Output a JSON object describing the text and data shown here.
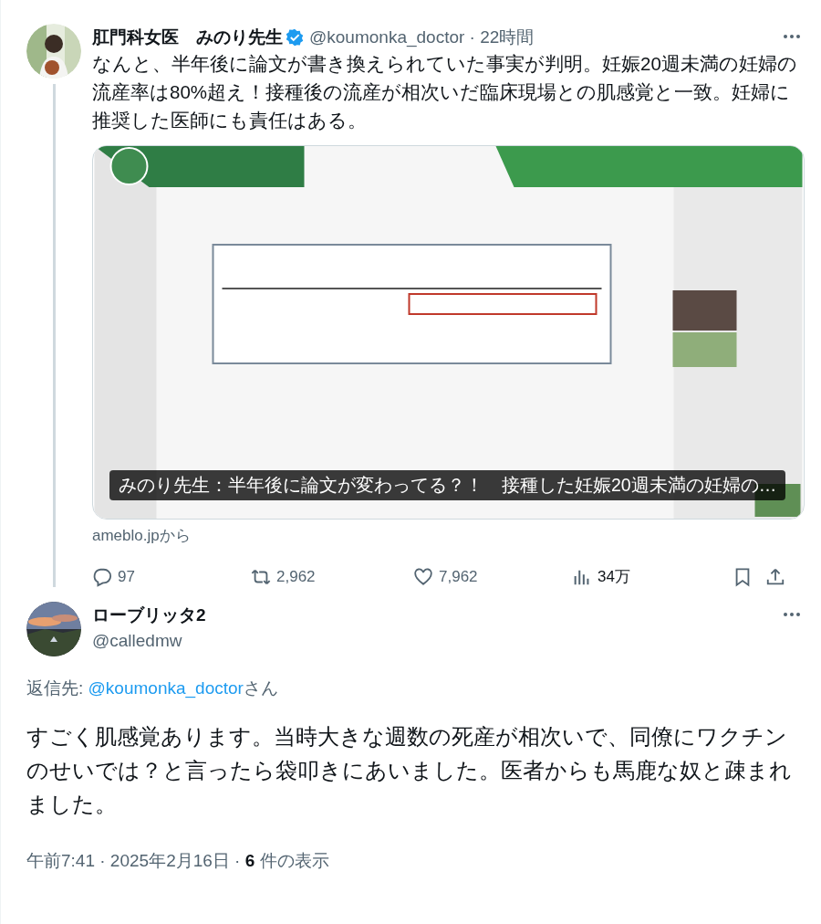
{
  "tweets": [
    {
      "kind": "parent",
      "name": "肛門科女医　みのり先生",
      "verified": true,
      "handle": "@koumonka_doctor",
      "separator": " · ",
      "time": "22時間",
      "text": "なんと、半年後に論文が書き換えられていた事実が判明。妊娠20週未満の妊婦の流産率は80%超え！接種後の流産が相次いだ臨床現場との肌感覚と一致。妊婦に推奨した医師にも責任はある。",
      "card": {
        "kind": "picture",
        "caption": "みのり先生：半年後に論文が変わってる？！　接種した妊娠20週未満の妊婦の…",
        "source": "ameblo.jpから"
      },
      "actions": [
        {
          "kind": "reply",
          "count": "97"
        },
        {
          "kind": "retweet",
          "count": "2,962"
        },
        {
          "kind": "like",
          "count": "7,962"
        },
        {
          "kind": "views",
          "count": "34万"
        },
        {
          "kind": "bookmark"
        },
        {
          "kind": "share"
        }
      ]
    },
    {
      "kind": "focus",
      "name": "ローブリッタ2",
      "verified": false,
      "handle": "@calledmw",
      "reply_to": {
        "label": "返信先: ",
        "handle": "@koumonka_doctor",
        "suffix": "さん"
      },
      "text": "すごく肌感覚あります。当時大きな週数の死産が相次いで、同僚にワクチンのせいでは？と言ったら袋叩きにあいました。医者からも馬鹿な奴と疎まれました。",
      "meta": {
        "time": "午前7:41 · 2025年2月16日 · ",
        "views": "6",
        "views_label": " 件の表示"
      }
    }
  ]
}
